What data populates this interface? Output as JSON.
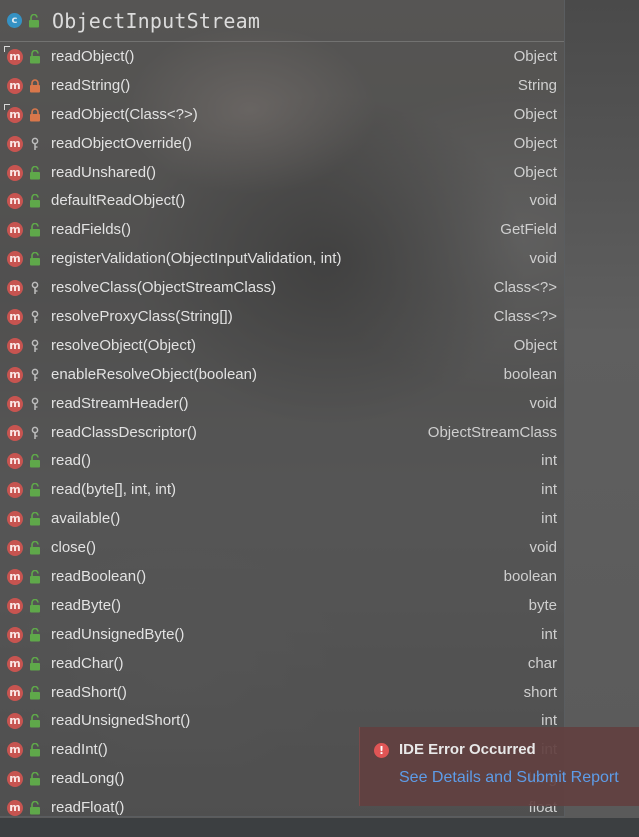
{
  "popup": {
    "class_kind_icon": "c-class-icon",
    "class_name": "ObjectInputStream",
    "methods": [
      {
        "name": "readObject()",
        "type": "Object",
        "vis": "public",
        "override": true
      },
      {
        "name": "readString()",
        "type": "String",
        "vis": "private",
        "override": false
      },
      {
        "name": "readObject(Class<?>)",
        "type": "Object",
        "vis": "private",
        "override": true
      },
      {
        "name": "readObjectOverride()",
        "type": "Object",
        "vis": "protected",
        "override": false
      },
      {
        "name": "readUnshared()",
        "type": "Object",
        "vis": "public",
        "override": false
      },
      {
        "name": "defaultReadObject()",
        "type": "void",
        "vis": "public",
        "override": false
      },
      {
        "name": "readFields()",
        "type": "GetField",
        "vis": "public",
        "override": false
      },
      {
        "name": "registerValidation(ObjectInputValidation, int)",
        "type": "void",
        "vis": "public",
        "override": false
      },
      {
        "name": "resolveClass(ObjectStreamClass)",
        "type": "Class<?>",
        "vis": "protected",
        "override": false
      },
      {
        "name": "resolveProxyClass(String[])",
        "type": "Class<?>",
        "vis": "protected",
        "override": false
      },
      {
        "name": "resolveObject(Object)",
        "type": "Object",
        "vis": "protected",
        "override": false
      },
      {
        "name": "enableResolveObject(boolean)",
        "type": "boolean",
        "vis": "protected",
        "override": false
      },
      {
        "name": "readStreamHeader()",
        "type": "void",
        "vis": "protected",
        "override": false
      },
      {
        "name": "readClassDescriptor()",
        "type": "ObjectStreamClass",
        "vis": "protected",
        "override": false
      },
      {
        "name": "read()",
        "type": "int",
        "vis": "public",
        "override": false
      },
      {
        "name": "read(byte[], int, int)",
        "type": "int",
        "vis": "public",
        "override": false
      },
      {
        "name": "available()",
        "type": "int",
        "vis": "public",
        "override": false
      },
      {
        "name": "close()",
        "type": "void",
        "vis": "public",
        "override": false
      },
      {
        "name": "readBoolean()",
        "type": "boolean",
        "vis": "public",
        "override": false
      },
      {
        "name": "readByte()",
        "type": "byte",
        "vis": "public",
        "override": false
      },
      {
        "name": "readUnsignedByte()",
        "type": "int",
        "vis": "public",
        "override": false
      },
      {
        "name": "readChar()",
        "type": "char",
        "vis": "public",
        "override": false
      },
      {
        "name": "readShort()",
        "type": "short",
        "vis": "public",
        "override": false
      },
      {
        "name": "readUnsignedShort()",
        "type": "int",
        "vis": "public",
        "override": false
      },
      {
        "name": "readInt()",
        "type": "int",
        "vis": "public",
        "override": false
      },
      {
        "name": "readLong()",
        "type": "long",
        "vis": "public",
        "override": false
      },
      {
        "name": "readFloat()",
        "type": "float",
        "vis": "public",
        "override": false
      }
    ]
  },
  "icons": {
    "method": "m-method-icon",
    "public": "open-lock-icon",
    "private": "lock-icon",
    "protected": "key-icon"
  },
  "colors": {
    "method_icon": "#c75450",
    "class_icon": "#3592c4",
    "public_lock": "#5fa84a",
    "private_lock": "#d9774b",
    "link": "#5d9ce8",
    "error": "#e05555"
  },
  "notification": {
    "title": "IDE Error Occurred",
    "link": "See Details and Submit Report"
  }
}
